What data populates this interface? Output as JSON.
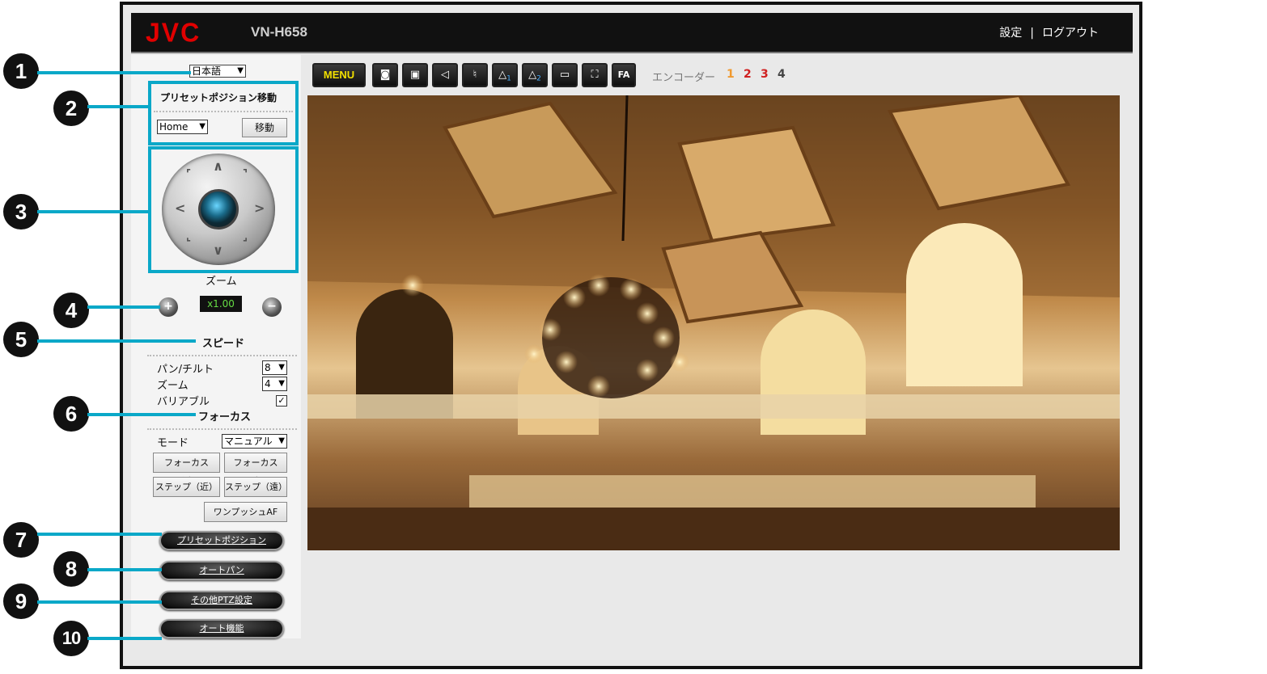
{
  "header": {
    "logo": "JVC",
    "model": "VN-H658",
    "settings_link": "設定",
    "separator": "|",
    "logout_link": "ログアウト"
  },
  "language": {
    "selected": "日本語"
  },
  "preset_move": {
    "title": "プリセットポジション移動",
    "selected": "Home",
    "move_button": "移動"
  },
  "zoom": {
    "label": "ズーム",
    "value": "x1.00",
    "in_icon": "zoom-in-icon",
    "out_icon": "zoom-out-icon"
  },
  "speed": {
    "title": "スピード",
    "pan_tilt_label": "パン/チルト",
    "pan_tilt_value": "8",
    "zoom_label": "ズーム",
    "zoom_value": "4",
    "variable_label": "バリアブル",
    "variable_checked": "✓"
  },
  "focus": {
    "title": "フォーカス",
    "mode_label": "モード",
    "mode_value": "マニュアル",
    "near_button": "フォーカス（近）",
    "far_button": "フォーカス（遠）",
    "step_near_button": "ステップ（近）",
    "step_far_button": "ステップ（遠）",
    "one_push_af_button": "ワンプッシュAF"
  },
  "bottom_buttons": {
    "preset": "プリセットポジション",
    "auto_pan": "オートパン",
    "other_ptz": "その他PTZ設定",
    "auto_function": "オート機能"
  },
  "toolbar": {
    "menu": "MENU",
    "icons": [
      "snapshot-icon",
      "record-icon",
      "speaker-icon",
      "microphone-icon",
      "alarm1-icon",
      "alarm2-icon",
      "fit-screen-icon",
      "fullscreen-icon",
      "focus-assist-icon"
    ],
    "fa_label": "FA",
    "alarm1_num": "1",
    "alarm2_num": "2"
  },
  "encoder": {
    "label": "エンコーダー",
    "e1": "1",
    "e2": "2",
    "e3": "3",
    "e4": "4",
    "colors": {
      "e1": "#f09a30",
      "e2": "#d02020",
      "e3": "#d02020",
      "e4": "#444444"
    }
  },
  "callouts": [
    "1",
    "2",
    "3",
    "4",
    "5",
    "6",
    "7",
    "8",
    "9",
    "10"
  ],
  "accent_color": "#0aa8c8"
}
